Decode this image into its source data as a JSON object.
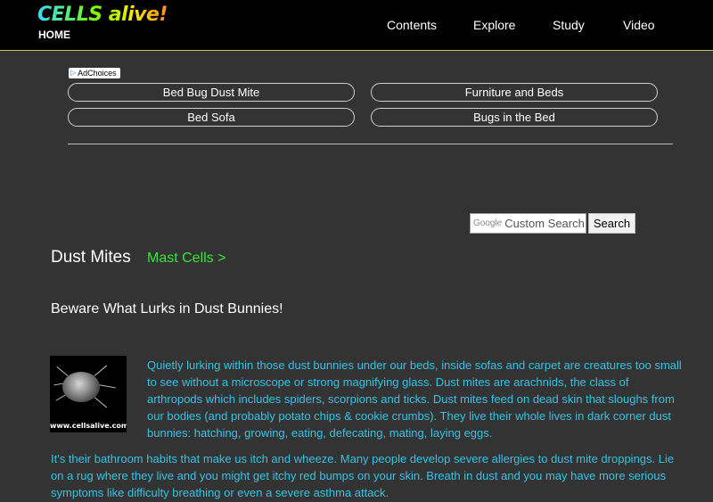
{
  "header": {
    "logo": "CELLS alive!",
    "home_label": "HOME",
    "nav": [
      "Contents",
      "Explore",
      "Study",
      "Video"
    ]
  },
  "ads": {
    "adchoices_label": "AdChoices",
    "links": [
      "Bed Bug Dust Mite",
      "Furniture and Beds",
      "Bed Sofa",
      "Bugs in the Bed"
    ]
  },
  "search": {
    "google_label": "Google",
    "placeholder": "Custom Search",
    "button_label": "Search"
  },
  "article": {
    "title": "Dust Mites",
    "next_link": "Mast Cells >",
    "subtitle": "Beware What Lurks in Dust Bunnies!",
    "image_caption": "www.cellsalive.com",
    "paragraphs": [
      "Quietly lurking within those dust bunnies under our beds, inside sofas and carpet are creatures too small to see without a microscope or strong magnifying glass. Dust mites are arachnids, the class of arthropods which includes spiders, scorpions and ticks. Dust mites feed on dead skin that sloughs from our bodies (and probably potato chips & cookie crumbs). They live their whole lives in dark corner dust bunnies: hatching, growing, eating, defecating, mating, laying eggs.",
      "It's their bathroom habits that make us itch and wheeze. Many people develop severe allergies to dust mite droppings. Lie on a rug where they live and you might get itchy red bumps on your skin. Breath in dust and you may have more serious symptoms like difficulty breathing or even a severe asthma attack."
    ]
  },
  "colors": {
    "background": "#333333",
    "header": "#000000",
    "body_text": "#33c3e6",
    "link_green": "#33e633"
  }
}
